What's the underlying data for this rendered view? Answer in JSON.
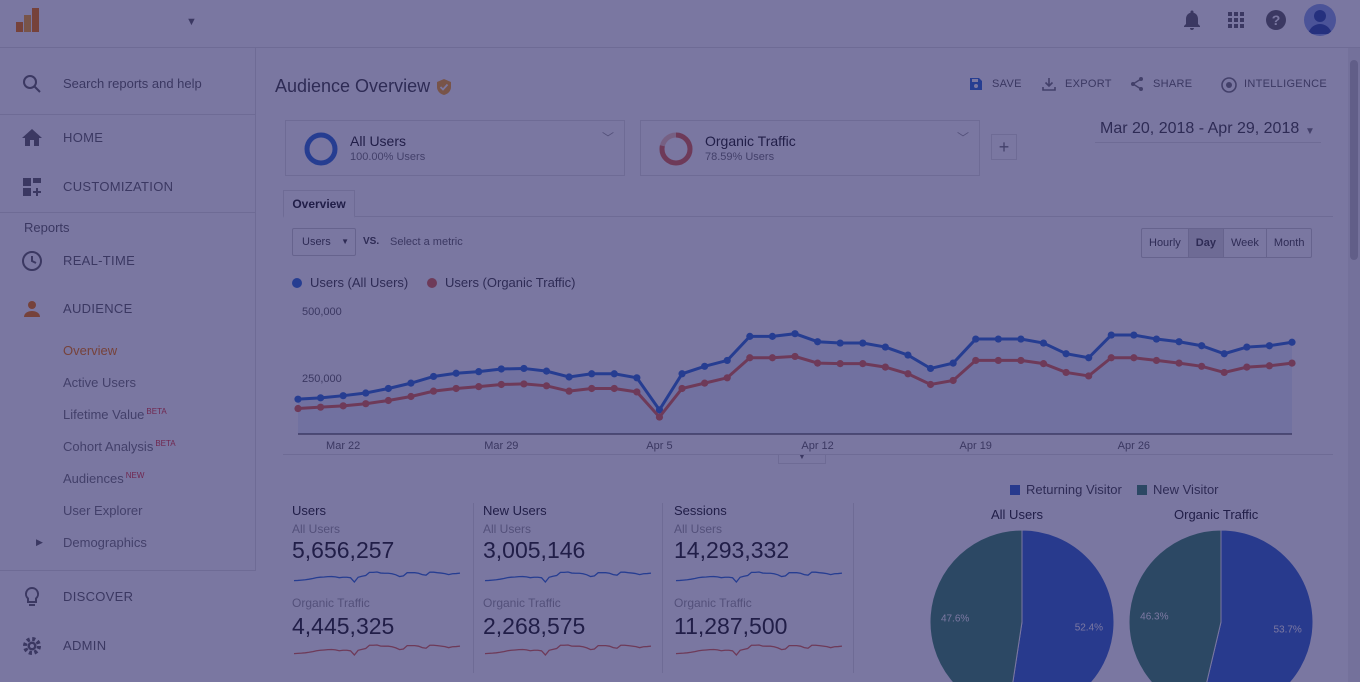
{
  "icons": {
    "logo": "analytics-logo",
    "notifications": "bell-icon",
    "apps": "apps-grid-icon",
    "help": "help-icon",
    "account": "account-avatar"
  },
  "sidebar": {
    "search_placeholder": "Search reports and help",
    "home": "HOME",
    "customization": "CUSTOMIZATION",
    "reports_heading": "Reports",
    "realtime": "REAL-TIME",
    "audience": "AUDIENCE",
    "audience_items": [
      {
        "label": "Overview",
        "badge": ""
      },
      {
        "label": "Active Users",
        "badge": ""
      },
      {
        "label": "Lifetime Value",
        "badge": "BETA"
      },
      {
        "label": "Cohort Analysis",
        "badge": "BETA"
      },
      {
        "label": "Audiences",
        "badge": "NEW"
      },
      {
        "label": "User Explorer",
        "badge": ""
      },
      {
        "label": "Demographics",
        "badge": ""
      }
    ],
    "discover": "DISCOVER",
    "admin": "ADMIN"
  },
  "header": {
    "title": "Audience Overview",
    "save": "SAVE",
    "export": "EXPORT",
    "share": "SHARE",
    "intelligence": "INTELLIGENCE"
  },
  "segments": [
    {
      "name": "All Users",
      "subtitle": "100.00% Users",
      "color": "#2f6fd8"
    },
    {
      "name": "Organic Traffic",
      "subtitle": "78.59% Users",
      "color": "#e0684b"
    }
  ],
  "date_range": "Mar 20, 2018 - Apr 29, 2018",
  "tabs": {
    "overview": "Overview"
  },
  "controls": {
    "metric": "Users",
    "vs": "VS.",
    "select_metric": "Select a metric",
    "granularity": [
      "Hourly",
      "Day",
      "Week",
      "Month"
    ],
    "granularity_selected": "Day"
  },
  "colors": {
    "all_users": "#2f6fd8",
    "organic": "#e0684b",
    "returning": "#3266cc",
    "new": "#3d8a66"
  },
  "chart_data": [
    {
      "type": "line",
      "series": [
        {
          "name": "Users (All Users)",
          "values": [
            185000,
            190000,
            198000,
            208000,
            225000,
            245000,
            270000,
            282000,
            288000,
            298000,
            300000,
            290000,
            268000,
            280000,
            280000,
            265000,
            145000,
            280000,
            308000,
            330000,
            420000,
            420000,
            430000,
            400000,
            395000,
            395000,
            380000,
            350000,
            300000,
            320000,
            410000,
            410000,
            410000,
            395000,
            355000,
            340000,
            425000,
            425000,
            410000,
            400000,
            385000,
            355000,
            380000,
            385000,
            398000
          ]
        },
        {
          "name": "Users (Organic Traffic)",
          "values": [
            150000,
            155000,
            160000,
            168000,
            180000,
            195000,
            215000,
            225000,
            232000,
            240000,
            242000,
            235000,
            215000,
            225000,
            225000,
            212000,
            118000,
            225000,
            245000,
            265000,
            340000,
            340000,
            345000,
            320000,
            318000,
            318000,
            305000,
            280000,
            240000,
            255000,
            330000,
            330000,
            330000,
            318000,
            285000,
            272000,
            340000,
            340000,
            330000,
            320000,
            308000,
            285000,
            305000,
            310000,
            320000
          ]
        }
      ],
      "y_ticks": [
        "500,000",
        "250,000"
      ],
      "ylim": [
        0,
        500000
      ],
      "x_ticks": [
        "Mar 22",
        "Mar 29",
        "Apr 5",
        "Apr 12",
        "Apr 19",
        "Apr 26"
      ],
      "grid": false
    },
    {
      "type": "pie",
      "title": "All Users",
      "slices": [
        {
          "name": "Returning Visitor",
          "value": 52.4,
          "label": "52.4%"
        },
        {
          "name": "New Visitor",
          "value": 47.6,
          "label": "47.6%"
        }
      ]
    },
    {
      "type": "pie",
      "title": "Organic Traffic",
      "slices": [
        {
          "name": "Returning Visitor",
          "value": 53.7,
          "label": "53.7%"
        },
        {
          "name": "New Visitor",
          "value": 46.3,
          "label": "46.3%"
        }
      ]
    }
  ],
  "scorecards": [
    {
      "title": "Users",
      "all_label": "All Users",
      "all_value": "5,656,257",
      "org_label": "Organic Traffic",
      "org_value": "4,445,325"
    },
    {
      "title": "New Users",
      "all_label": "All Users",
      "all_value": "3,005,146",
      "org_label": "Organic Traffic",
      "org_value": "2,268,575"
    },
    {
      "title": "Sessions",
      "all_label": "All Users",
      "all_value": "14,293,332",
      "org_label": "Organic Traffic",
      "org_value": "11,287,500"
    }
  ],
  "pie_legend": [
    "Returning Visitor",
    "New Visitor"
  ]
}
